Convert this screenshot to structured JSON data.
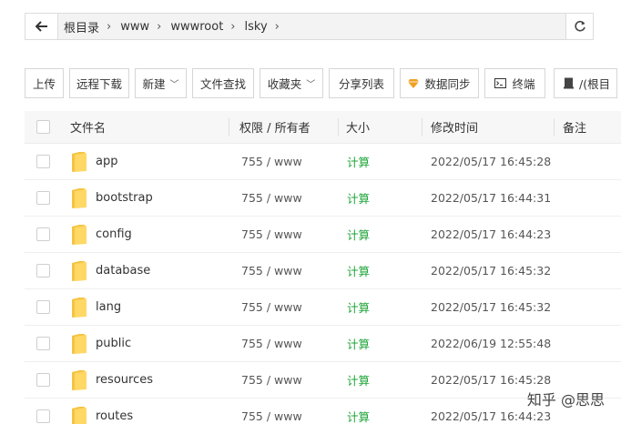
{
  "breadcrumb": {
    "items": [
      "根目录",
      "www",
      "wwwroot",
      "lsky"
    ]
  },
  "toolbar": {
    "upload": "上传",
    "remote_download": "远程下载",
    "new": "新建",
    "file_search": "文件查找",
    "favorites": "收藏夹",
    "share_list": "分享列表",
    "data_sync": "数据同步",
    "terminal": "终端",
    "disk": "/(根目"
  },
  "table": {
    "headers": {
      "name": "文件名",
      "perm": "权限 / 所有者",
      "size": "大小",
      "time": "修改时间",
      "note": "备注"
    },
    "rows": [
      {
        "name": "app",
        "perm": "755 / www",
        "size": "计算",
        "time": "2022/05/17 16:45:28"
      },
      {
        "name": "bootstrap",
        "perm": "755 / www",
        "size": "计算",
        "time": "2022/05/17 16:44:31"
      },
      {
        "name": "config",
        "perm": "755 / www",
        "size": "计算",
        "time": "2022/05/17 16:44:23"
      },
      {
        "name": "database",
        "perm": "755 / www",
        "size": "计算",
        "time": "2022/05/17 16:45:32"
      },
      {
        "name": "lang",
        "perm": "755 / www",
        "size": "计算",
        "time": "2022/05/17 16:45:32"
      },
      {
        "name": "public",
        "perm": "755 / www",
        "size": "计算",
        "time": "2022/06/19 12:55:48"
      },
      {
        "name": "resources",
        "perm": "755 / www",
        "size": "计算",
        "time": "2022/05/17 16:45:28"
      },
      {
        "name": "routes",
        "perm": "755 / www",
        "size": "计算",
        "time": "2022/05/17 16:44:23"
      }
    ]
  },
  "watermark": "知乎 @思思",
  "colors": {
    "accent_green": "#20a53a",
    "folder_yellow": "#f5c342"
  },
  "icons": {
    "back": "arrow-left-icon",
    "refresh": "refresh-icon",
    "data_sync": "diamond-icon",
    "terminal": "terminal-icon",
    "disk": "disk-icon",
    "folder": "folder-icon"
  }
}
